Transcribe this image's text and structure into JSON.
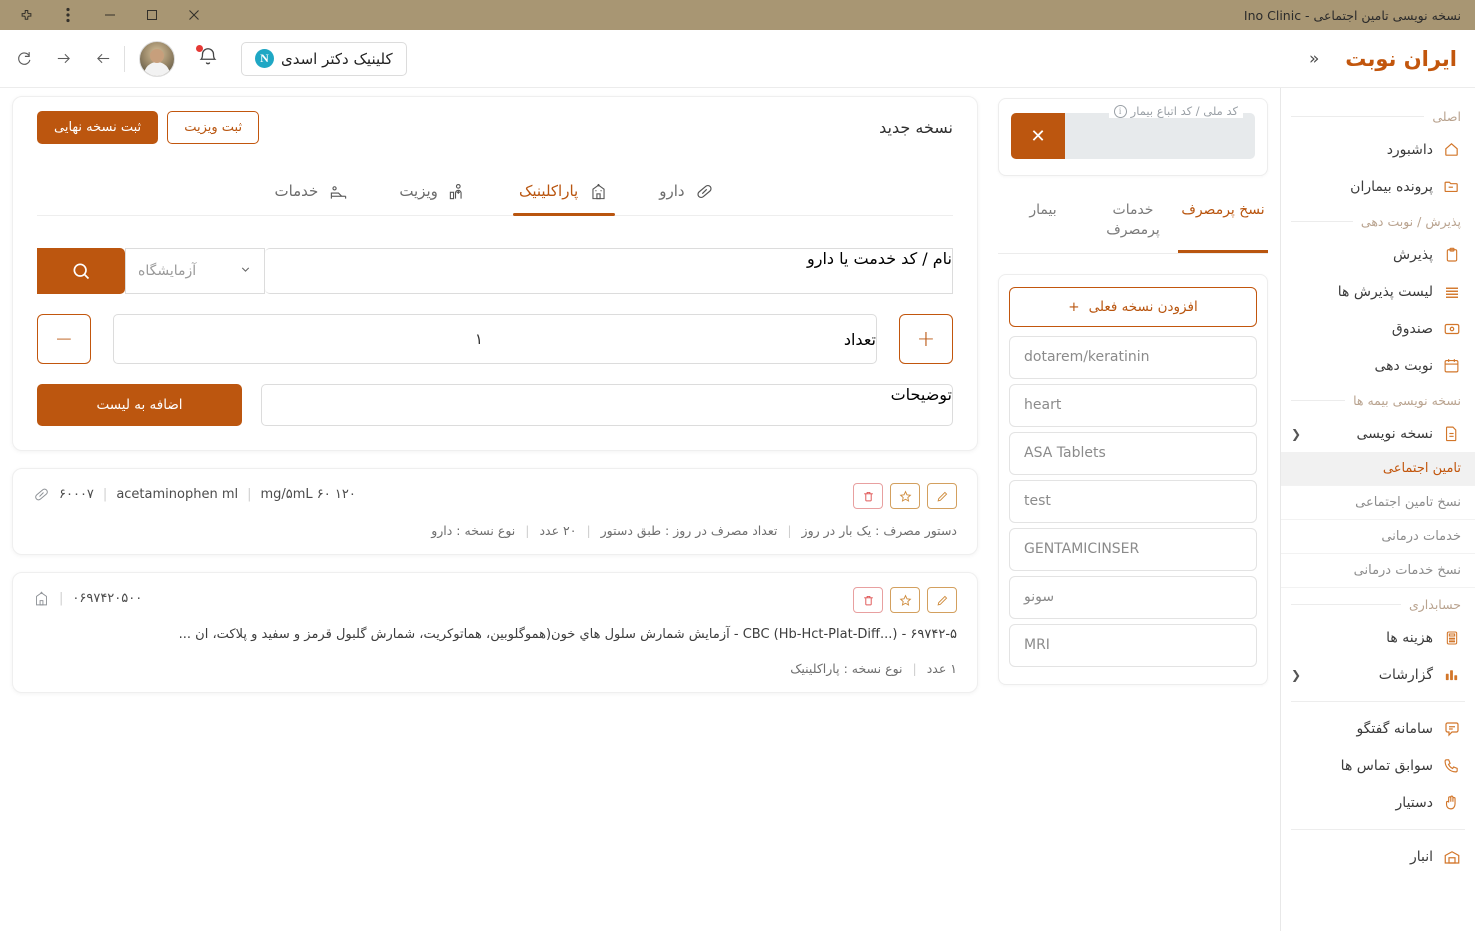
{
  "browser": {
    "tab_title": "نسخه نویسی تامین اجتماعی - Ino Clinic",
    "extensions_icon": "puzzle-icon",
    "menu_icon": "kebab-menu-icon",
    "minimize": "–",
    "maximize": "▢",
    "close": "✕"
  },
  "appheader": {
    "brand": "ایران نوبت",
    "collapse": "«",
    "clinic_name": "کلینیک دکتر اسدی",
    "clinic_logo_text": "N",
    "back": "←",
    "forward": "→",
    "reload": "⟳"
  },
  "sidebar": {
    "sections": [
      {
        "title": "اصلی",
        "items": [
          {
            "label": "داشبورد",
            "icon": "home-icon",
            "chevron": ""
          },
          {
            "label": "پرونده بیماران",
            "icon": "folder-icon",
            "chevron": ""
          }
        ]
      },
      {
        "title": "پذیرش / نوبت دهی",
        "items": [
          {
            "label": "پذیرش",
            "icon": "clipboard-icon",
            "chevron": ""
          },
          {
            "label": "لیست پذیرش ها",
            "icon": "list-icon",
            "chevron": ""
          },
          {
            "label": "صندوق",
            "icon": "cashbox-icon",
            "chevron": ""
          },
          {
            "label": "نوبت دهی",
            "icon": "calendar-icon",
            "chevron": ""
          }
        ]
      },
      {
        "title": "نسخه نویسی بیمه ها",
        "items": [
          {
            "label": "نسخه نویسی",
            "icon": "document-icon",
            "chevron": "❮"
          }
        ],
        "subitems": [
          {
            "label": "تامین اجتماعی",
            "active": true
          },
          {
            "label": "نسخ تامین اجتماعی",
            "active": false
          },
          {
            "label": "خدمات درمانی",
            "active": false
          },
          {
            "label": "نسخ خدمات درمانی",
            "active": false
          }
        ]
      },
      {
        "title": "حسابداری",
        "items": [
          {
            "label": "هزینه ها",
            "icon": "calculator-icon",
            "chevron": ""
          },
          {
            "label": "گزارشات",
            "icon": "bar-chart-icon",
            "chevron": "❮"
          }
        ]
      },
      {
        "title": "",
        "items": [
          {
            "label": "سامانه گفتگو",
            "icon": "chat-icon",
            "chevron": ""
          },
          {
            "label": "سوابق تماس ها",
            "icon": "phone-icon",
            "chevron": ""
          },
          {
            "label": "دستیار",
            "icon": "hand-icon",
            "chevron": ""
          }
        ]
      },
      {
        "title": "",
        "items": [
          {
            "label": "انبار",
            "icon": "warehouse-icon",
            "chevron": ""
          }
        ]
      }
    ]
  },
  "patient_panel": {
    "national_code_label": "کد ملی / کد اتباع بیمار",
    "national_code_value": "",
    "info_icon": "info-icon",
    "clear_icon": "✕",
    "tabs": [
      {
        "label": "بیمار",
        "active": false
      },
      {
        "label": "خدمات پرمصرف",
        "active": false
      },
      {
        "label": "نسخ پرمصرف",
        "active": true
      }
    ],
    "add_current_label": "افزودن نسخه فعلی",
    "add_icon": "plus-icon",
    "presets": [
      "dotarem/keratinin",
      "heart",
      "ASA Tablets",
      "test",
      "GENTAMICINSER",
      "سونو",
      "MRI"
    ]
  },
  "prescription": {
    "title": "نسخه جدید",
    "btn_visit": "ثبت ویزیت",
    "btn_final": "ثبت نسخه نهایی",
    "tabs": [
      {
        "label": "دارو",
        "icon": "pill-icon",
        "active": false
      },
      {
        "label": "پاراکلینیک",
        "icon": "hospital-icon",
        "active": true
      },
      {
        "label": "ویزیت",
        "icon": "doctor-desk-icon",
        "active": false
      },
      {
        "label": "خدمات",
        "icon": "patient-bed-icon",
        "active": false
      }
    ],
    "search_label": "نام / کد خدمت یا دارو",
    "search_value": "",
    "search_placeholder": "",
    "select_value": "آزمایشگاه",
    "search_icon": "search-icon",
    "chevron_icon": "chevron-down-icon",
    "qty_label": "تعداد",
    "qty_value": "۱",
    "minus": "−",
    "plus": "+",
    "desc_label": "توضیحات",
    "desc_value": "",
    "add_to_list": "اضافه به لیست"
  },
  "items": [
    {
      "icon": "pill-icon",
      "code": "۶۰۰۰۷",
      "name": "acetaminophen ml",
      "dose": "۱۲۰ mg/۵mL ۶۰",
      "description": "",
      "meta": [
        "نوع نسخه : دارو",
        "۲۰ عدد",
        "تعداد مصرف در روز : طبق دستور",
        "دستور مصرف : یک بار در روز"
      ],
      "actions": {
        "delete": "delete-icon",
        "favorite": "star-icon",
        "edit": "pencil-icon"
      }
    },
    {
      "icon": "hospital-icon",
      "code": "۰۶۹۷۴۲۰۵۰۰",
      "name": "",
      "dose": "",
      "description": "۶۹۷۴۲-۵ - (...CBC (Hb-Hct-Plat-Diff - آزمایش شمارش سلول هاي خون(هموگلوبین، هماتوکریت، شمارش گلبول قرمز و سفید و پلاکت، ان ...",
      "meta": [
        "نوع نسخه : پاراکلینیک",
        "۱ عدد"
      ],
      "actions": {
        "delete": "delete-icon",
        "favorite": "star-icon",
        "edit": "pencil-icon"
      }
    }
  ],
  "colors": {
    "brand_orange": "#bc560f",
    "brand_orange_light": "#d2762a",
    "titlebar": "#a89673",
    "danger": "#e05a5a",
    "muted": "#8b8b8b"
  }
}
